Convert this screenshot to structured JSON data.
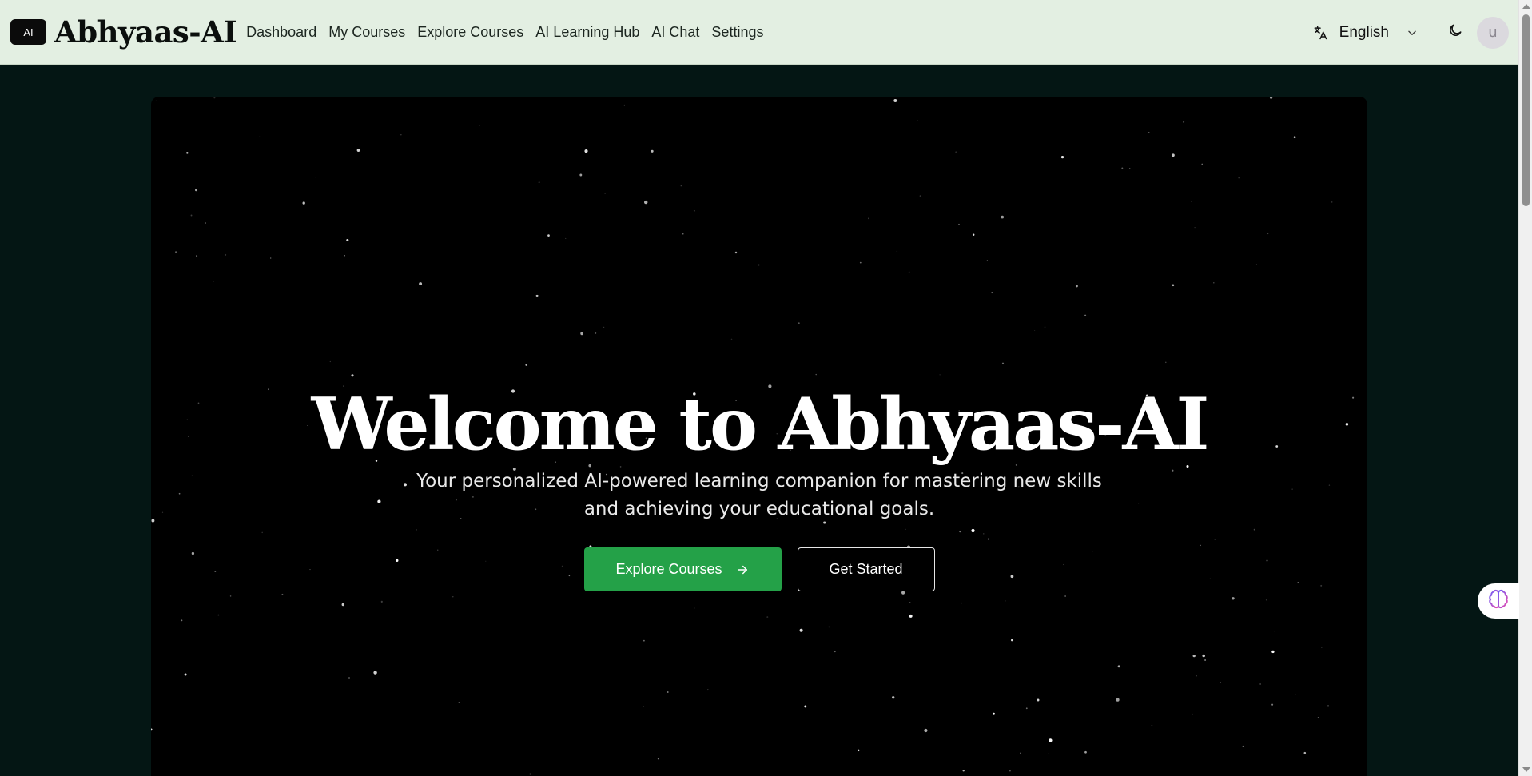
{
  "header": {
    "logo_badge": "AI",
    "brand": "Abhyaas-AI",
    "nav": [
      {
        "label": "Dashboard"
      },
      {
        "label": "My Courses"
      },
      {
        "label": "Explore Courses"
      },
      {
        "label": "AI Learning Hub"
      },
      {
        "label": "AI Chat"
      },
      {
        "label": "Settings"
      }
    ],
    "language": {
      "icon": "translate-icon",
      "selected": "English",
      "caret": "chevron-down-icon"
    },
    "theme_toggle_icon": "moon-icon",
    "avatar_initial": "u"
  },
  "hero": {
    "title": "Welcome to Abhyaas-AI",
    "subtitle": "Your personalized AI-powered learning companion for mastering new skills and achieving your educational goals.",
    "primary_button": {
      "label": "Explore Courses",
      "icon": "arrow-right-icon"
    },
    "secondary_button": {
      "label": "Get Started"
    },
    "background": "starfield"
  },
  "assistant": {
    "icon": "brain-icon"
  },
  "colors": {
    "header_bg": "#e3efe2",
    "page_bg": "#041614",
    "hero_bg": "#000000",
    "primary": "#24a148",
    "text_light": "#ffffff"
  }
}
